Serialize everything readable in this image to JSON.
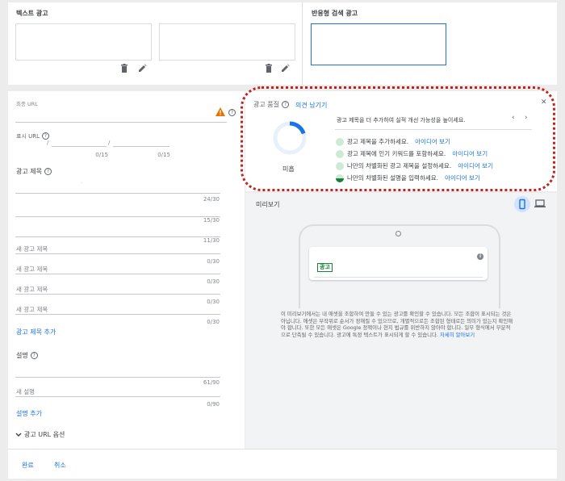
{
  "top": {
    "text_ad_title": "텍스트 광고",
    "responsive_ad_title": "반응형 검색 광고"
  },
  "form": {
    "final_url_label": "최종 URL",
    "display_url_label": "표시 URL",
    "display_path_sep1": "/",
    "display_path_sep2": "/",
    "path1_counter": "0/15",
    "path2_counter": "0/15",
    "headlines_label": "광고 제목",
    "headline_placeholder_dot": ".",
    "headline_counters": [
      "24/30",
      "15/30",
      "11/30",
      "0/30",
      "0/30",
      "0/30",
      "0/30"
    ],
    "new_headline_placeholder": "새 광고 제목",
    "add_headline": "광고 제목 추가",
    "description_label": "설명",
    "description_counters": [
      "61/90",
      "0/90"
    ],
    "new_description_placeholder": "새 설명",
    "add_description": "설명 추가",
    "url_options": "광고 URL 옵션"
  },
  "ad_strength": {
    "title": "광고 품질",
    "feedback_link": "의견 남기기",
    "rating": "미흡",
    "headline_tip": "광고 제목을 더 추가하여 실적 개선 가능성을 높이세요.",
    "tips": [
      {
        "text": "광고 제목을 추가하세요.",
        "link": "아이디어 보기"
      },
      {
        "text": "광고 제목에 인기 키워드를 포함하세요.",
        "link": "아이디어 보기"
      },
      {
        "text": "나만의 차별화된 광고 제목을 설정하세요.",
        "link": "아이디어 보기"
      },
      {
        "text": "나만의 차별화된 설명을 입력하세요.",
        "link": "아이디어 보기"
      }
    ],
    "progress": 0.2
  },
  "preview": {
    "title": "미리보기",
    "ad_badge": "광고",
    "disclaimer": "이 미리보기에서는 내 애셋을 조합하여 만들 수 있는 광고를 확인할 수 있습니다. 모든 조합이 표시되는 것은 아닙니다. 애셋은 무작위로 순서가 정해질 수 있으므로, 개별적으로든 조합된 형태로든 의미가 있는지 확인해야 합니다. 또한 모든 애셋은 Google 정책이나 현지 법규를 위반하지 않아야 합니다. 일부 형식에서 부분적으로 단축될 수 있습니다. 광고에 특정 텍스트가 표시되게 할 수 있습니다.",
    "learn_more": "자세히 알아보기"
  },
  "footer": {
    "done": "완료",
    "cancel": "취소"
  },
  "colors": {
    "accent": "#1a73e8",
    "warning": "#e37400",
    "highlight_ring": "#c5221f",
    "ad_badge_green": "#188038"
  }
}
